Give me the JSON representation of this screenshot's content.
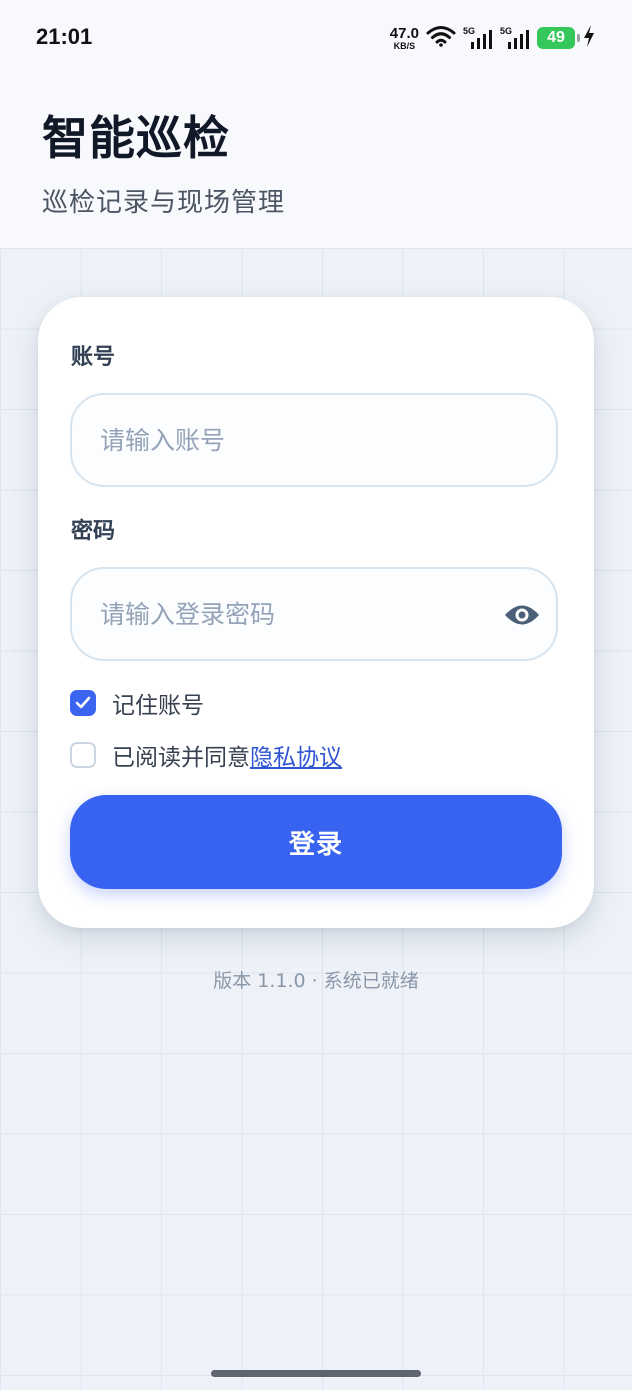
{
  "status_bar": {
    "time": "21:01",
    "net_speed": "47.0",
    "net_unit": "KB/S",
    "signal1_tag": "5G",
    "signal2_tag": "5G",
    "battery": "49",
    "battery_color": "#35c759"
  },
  "header": {
    "title": "智能巡检",
    "subtitle": "巡检记录与现场管理"
  },
  "form": {
    "account_label": "账号",
    "account_placeholder": "请输入账号",
    "account_value": "",
    "password_label": "密码",
    "password_placeholder": "请输入登录密码",
    "password_value": "",
    "password_toggle_icon": "eye-icon",
    "remember_label": "记住账号",
    "remember_checked": true,
    "agree_text": "已阅读并同意",
    "privacy_link": "隐私协议",
    "agree_checked": false,
    "login_button": "登录"
  },
  "footer": {
    "version_text": "版本 1.1.0 · 系统已就绪"
  },
  "colors": {
    "accent": "#3763f0",
    "link": "#2f55d4",
    "background": "#eef2f8"
  }
}
